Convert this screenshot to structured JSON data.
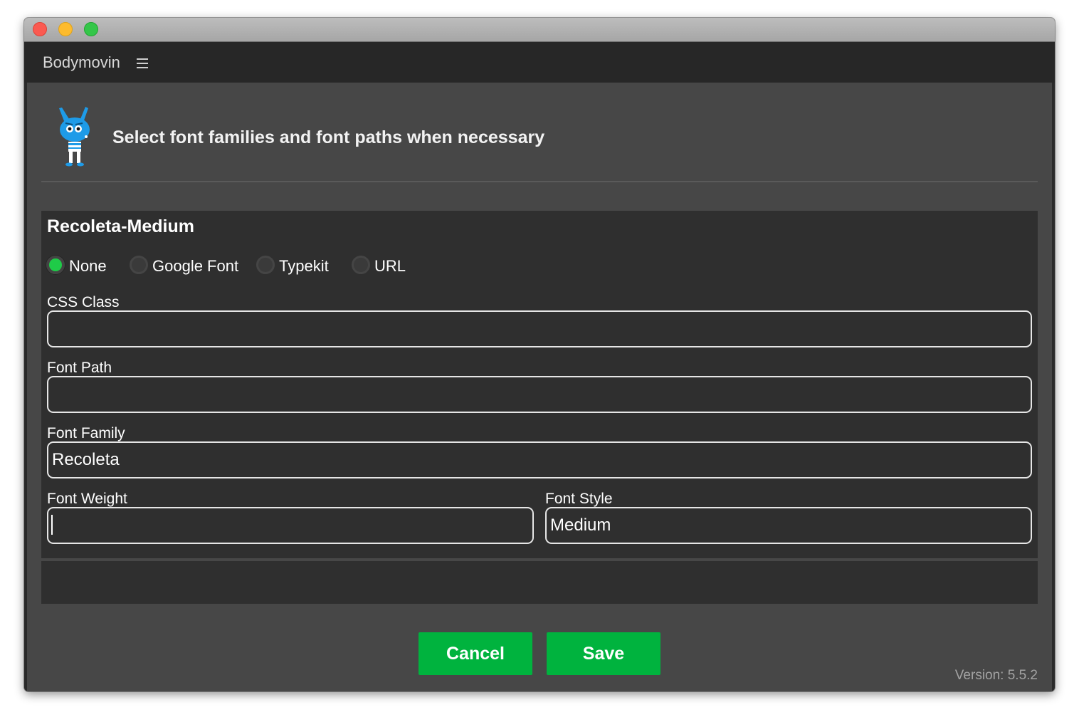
{
  "app": {
    "title": "Bodymovin",
    "menu_icon": "hamburger-icon",
    "mascot_icon": "bodymovin-mascot-icon"
  },
  "header": {
    "text": "Select font families and font paths when necessary"
  },
  "font": {
    "name": "Recoleta-Medium",
    "source_options": [
      {
        "label": "None",
        "selected": true
      },
      {
        "label": "Google Font",
        "selected": false
      },
      {
        "label": "Typekit",
        "selected": false
      },
      {
        "label": "URL",
        "selected": false
      }
    ],
    "fields": {
      "css_class": {
        "label": "CSS Class",
        "value": ""
      },
      "font_path": {
        "label": "Font Path",
        "value": ""
      },
      "font_family": {
        "label": "Font Family",
        "value": "Recoleta"
      },
      "font_weight": {
        "label": "Font Weight",
        "value": ""
      },
      "font_style": {
        "label": "Font Style",
        "value": "Medium"
      }
    }
  },
  "buttons": {
    "cancel": "Cancel",
    "save": "Save"
  },
  "version": "Version: 5.5.2",
  "colors": {
    "accent": "#00b33e",
    "radio_selected": "#1fcb48",
    "background": "#474747",
    "panel": "#2f2f2f",
    "appbar": "#272727"
  }
}
